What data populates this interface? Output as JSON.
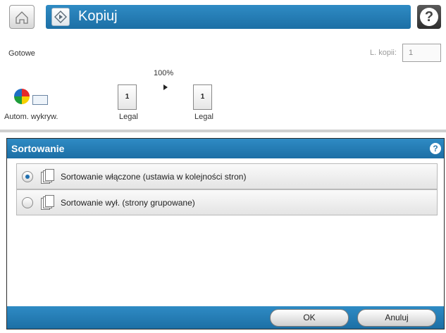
{
  "header": {
    "title": "Kopiuj",
    "home_icon": "home-icon",
    "copy_icon": "copy-start-icon",
    "help_icon": "help-icon",
    "help_glyph": "?"
  },
  "status": {
    "text": "Gotowe",
    "copies_label": "L. kopii:",
    "copies_value": "1"
  },
  "preview": {
    "zoom": "100%",
    "source_page_number": "1",
    "source_size": "Legal",
    "target_page_number": "1",
    "target_size": "Legal",
    "color_mode_label": "Autom. wykryw."
  },
  "panel": {
    "title": "Sortowanie",
    "help_glyph": "?",
    "options": [
      {
        "label": "Sortowanie włączone (ustawia w kolejności stron)",
        "selected": true
      },
      {
        "label": "Sortowanie wył. (strony grupowane)",
        "selected": false
      }
    ],
    "ok_label": "OK",
    "cancel_label": "Anuluj"
  }
}
